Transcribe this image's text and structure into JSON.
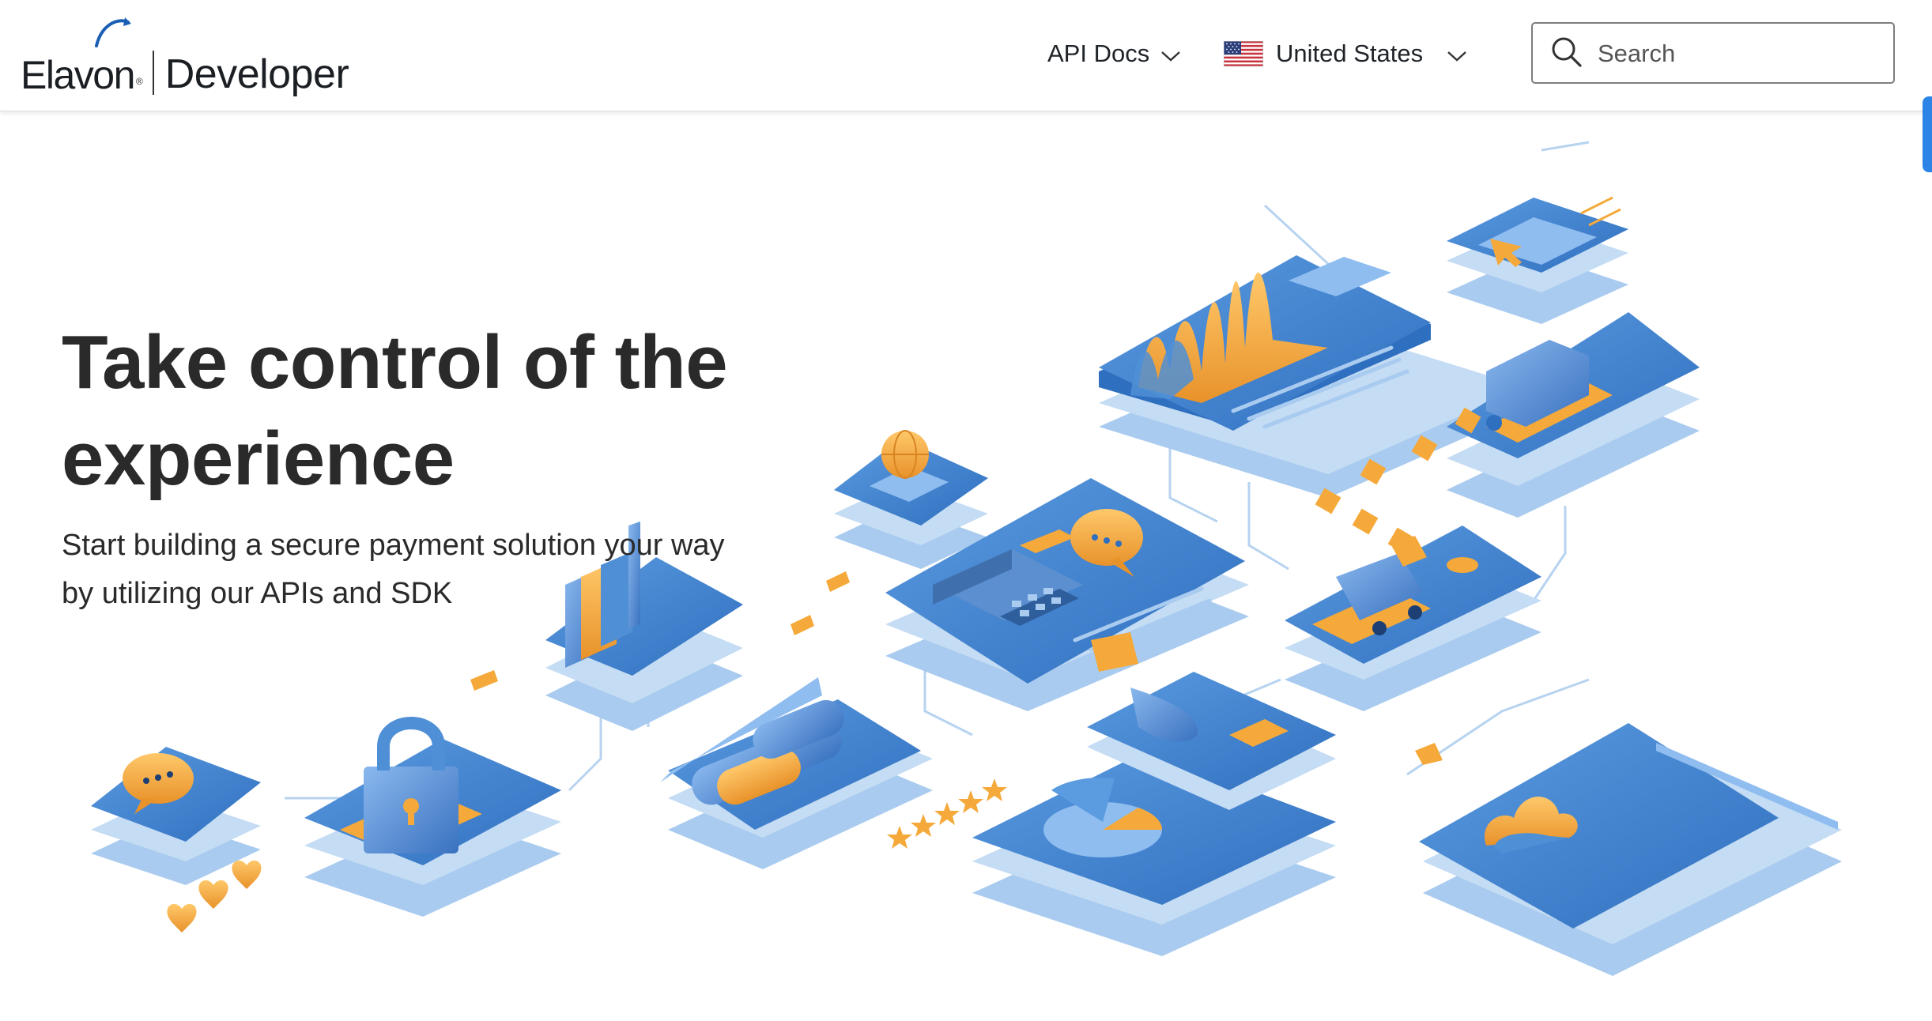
{
  "header": {
    "logo": {
      "brand": "Elavon",
      "registered": "®",
      "product": "Developer"
    },
    "nav": {
      "api_docs": {
        "label": "API Docs",
        "icon": "chevron-down-icon"
      },
      "country": {
        "label": "United States",
        "flag_icon": "us-flag-icon",
        "icon": "chevron-down-icon"
      }
    },
    "search": {
      "placeholder": "Search",
      "value": "",
      "icon": "search-icon"
    }
  },
  "hero": {
    "title": "Take control of the experience",
    "subtitle": "Start building a secure payment solution your way by utilizing our APIs and SDK"
  },
  "colors": {
    "brand_blue": "#2f6fbf",
    "mid_blue": "#4f8fd6",
    "light_blue": "#a9cbef",
    "accent_orange": "#f5a93a",
    "text_dark": "#2a2a2a",
    "scroll_tab": "#2d84e7"
  }
}
